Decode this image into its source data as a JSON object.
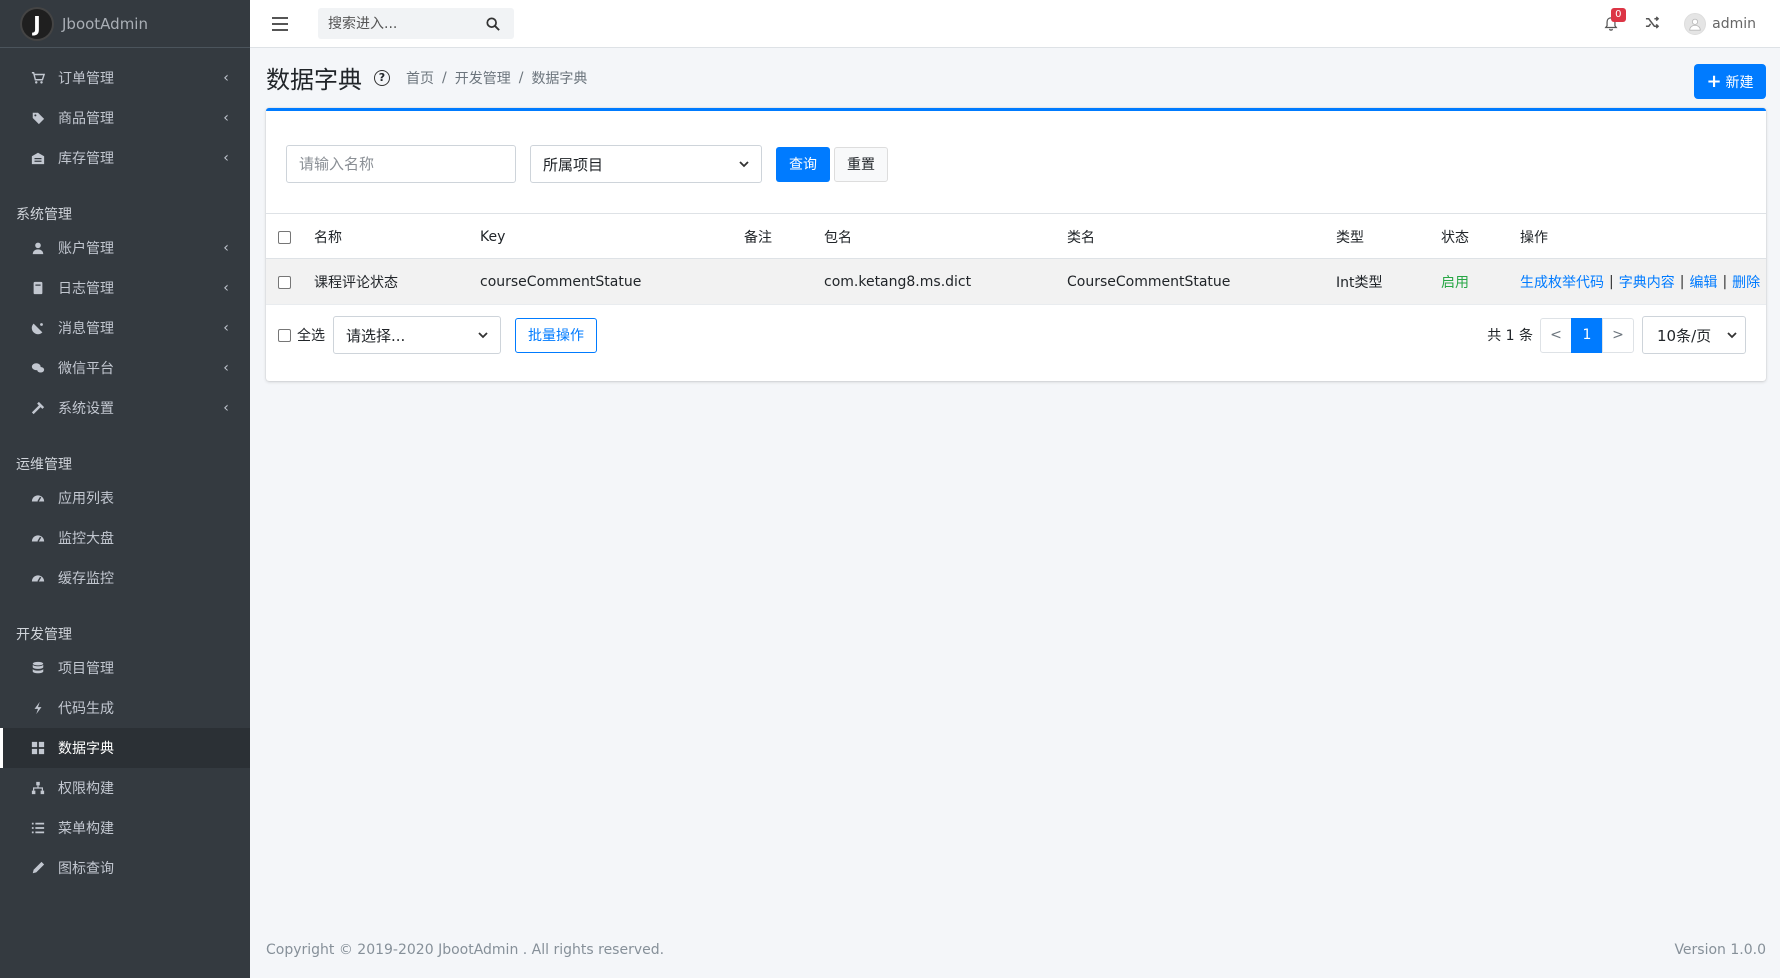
{
  "brand": {
    "logo_letter": "J",
    "name": "JbootAdmin"
  },
  "sidebar": {
    "group_top": [
      {
        "label": "订单管理",
        "icon": "cart-icon"
      },
      {
        "label": "商品管理",
        "icon": "tag-icon"
      },
      {
        "label": "库存管理",
        "icon": "warehouse-icon"
      }
    ],
    "headers": {
      "system": "系统管理",
      "ops": "运维管理",
      "dev": "开发管理"
    },
    "system_items": [
      {
        "label": "账户管理",
        "icon": "user-icon"
      },
      {
        "label": "日志管理",
        "icon": "book-icon"
      },
      {
        "label": "消息管理",
        "icon": "satellite-icon"
      },
      {
        "label": "微信平台",
        "icon": "wechat-icon"
      },
      {
        "label": "系统设置",
        "icon": "hammer-icon"
      }
    ],
    "ops_items": [
      {
        "label": "应用列表",
        "icon": "gauge-icon"
      },
      {
        "label": "监控大盘",
        "icon": "gauge-icon"
      },
      {
        "label": "缓存监控",
        "icon": "gauge-icon"
      }
    ],
    "dev_items": [
      {
        "label": "项目管理",
        "icon": "database-icon"
      },
      {
        "label": "代码生成",
        "icon": "bolt-icon"
      },
      {
        "label": "数据字典",
        "icon": "grid-icon",
        "active": true
      },
      {
        "label": "权限构建",
        "icon": "sitemap-icon"
      },
      {
        "label": "菜单构建",
        "icon": "list-icon"
      },
      {
        "label": "图标查询",
        "icon": "pen-icon"
      }
    ],
    "caret": "‹"
  },
  "topbar": {
    "search_placeholder": "搜索进入...",
    "notification_count": "0",
    "username": "admin"
  },
  "page": {
    "title": "数据字典",
    "breadcrumb": [
      "首页",
      "开发管理",
      "数据字典"
    ],
    "breadcrumb_sep": "/",
    "new_button": "新建"
  },
  "filter": {
    "name_placeholder": "请输入名称",
    "project_select": "所属项目",
    "query_button": "查询",
    "reset_button": "重置"
  },
  "table": {
    "columns": [
      "名称",
      "Key",
      "备注",
      "包名",
      "类名",
      "类型",
      "状态",
      "操作"
    ],
    "rows": [
      {
        "name": "课程评论状态",
        "key": "courseCommentStatue",
        "remark": "",
        "package": "com.ketang8.ms.dict",
        "class_name": "CourseCommentStatue",
        "type": "Int类型",
        "status": "启用",
        "actions": [
          "生成枚举代码",
          "字典内容",
          "编辑",
          "删除"
        ]
      }
    ]
  },
  "batch": {
    "select_all": "全选",
    "select_placeholder": "请选择...",
    "batch_button": "批量操作"
  },
  "pagination": {
    "total": "共 1 条",
    "prev": "<",
    "current": "1",
    "next": ">",
    "page_size": "10条/页"
  },
  "footer": {
    "copyright": "Copyright © 2019-2020 JbootAdmin . All rights reserved.",
    "version": "Version 1.0.0"
  },
  "colors": {
    "primary": "#007bff",
    "sidebar_bg": "#343a40",
    "success": "#28a745",
    "danger": "#dc3545"
  }
}
